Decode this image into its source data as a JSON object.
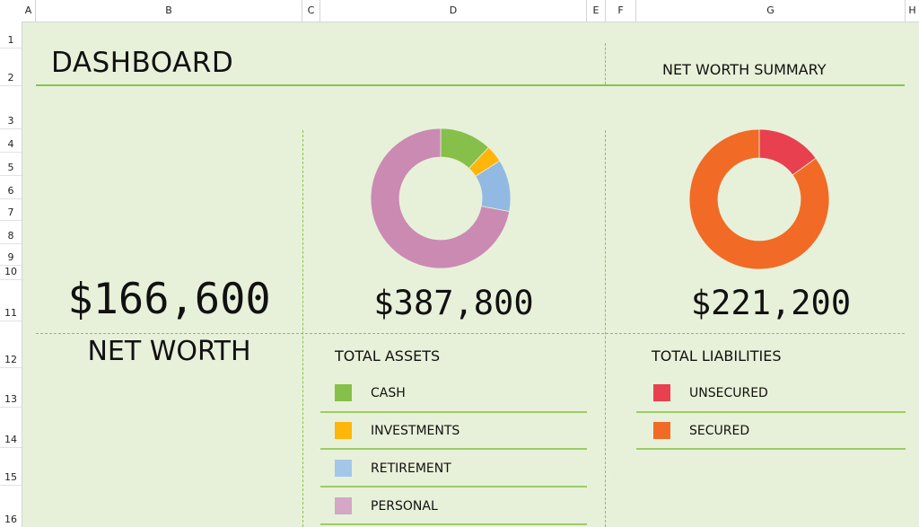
{
  "columns": [
    "A",
    "B",
    "C",
    "D",
    "E",
    "F",
    "G",
    "H"
  ],
  "rows": [
    "1",
    "2",
    "3",
    "4",
    "5",
    "6",
    "7",
    "8",
    "9",
    "10",
    "11",
    "12",
    "13",
    "14",
    "15",
    "16"
  ],
  "dashboard": {
    "title": "DASHBOARD",
    "summary_label": "NET WORTH SUMMARY"
  },
  "net_worth": {
    "value": "$166,600",
    "label": "NET WORTH"
  },
  "assets": {
    "value": "$387,800",
    "label": "TOTAL ASSETS",
    "items": [
      {
        "label": "CASH",
        "color": "#86c04a"
      },
      {
        "label": "INVESTMENTS",
        "color": "#ffb50a"
      },
      {
        "label": "RETIREMENT",
        "color": "#a4c6e8"
      },
      {
        "label": "PERSONAL",
        "color": "#d4a7c6"
      }
    ]
  },
  "liabilities": {
    "value": "$221,200",
    "label": "TOTAL LIABILITIES",
    "items": [
      {
        "label": "UNSECURED",
        "color": "#e8404f"
      },
      {
        "label": "SECURED",
        "color": "#f26b26"
      }
    ]
  },
  "chart_data": [
    {
      "type": "pie",
      "title": "",
      "categories": [
        "CASH",
        "INVESTMENTS",
        "RETIREMENT",
        "PERSONAL"
      ],
      "values": [
        12,
        4,
        12,
        72
      ],
      "colors": [
        "#86c04a",
        "#ffb50a",
        "#92b9e1",
        "#cb8ab1"
      ]
    },
    {
      "type": "pie",
      "title": "",
      "categories": [
        "UNSECURED",
        "SECURED"
      ],
      "values": [
        15,
        85
      ],
      "colors": [
        "#e8404f",
        "#f26b26"
      ]
    }
  ]
}
